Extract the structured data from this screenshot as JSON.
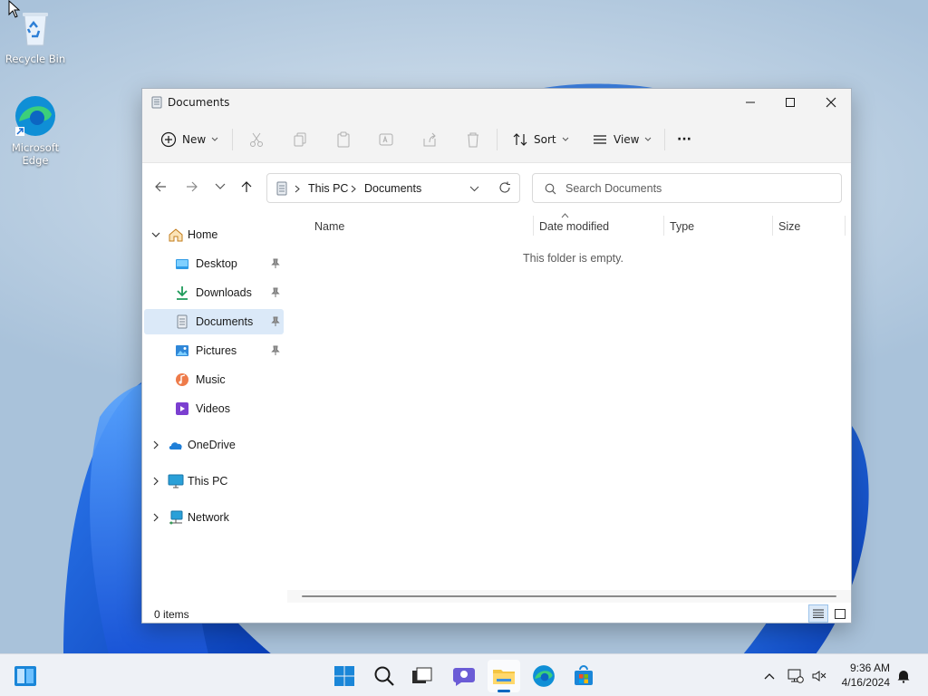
{
  "desktop": {
    "icons": [
      {
        "label": "Recycle Bin",
        "icon": "recycle-bin-icon"
      },
      {
        "label": "Microsoft Edge",
        "icon": "edge-icon"
      }
    ]
  },
  "window": {
    "title": "Documents",
    "caption_buttons": [
      "minimize-icon",
      "maximize-icon",
      "close-icon"
    ]
  },
  "commandbar": {
    "new_label": "New",
    "sort_label": "Sort",
    "view_label": "View",
    "more_label": "···"
  },
  "navigation": {
    "breadcrumb": [
      "This PC",
      "Documents"
    ],
    "search_placeholder": "Search Documents"
  },
  "sidebar": {
    "items": [
      {
        "label": "Home",
        "icon": "home-icon",
        "expanded": true
      },
      {
        "label": "Desktop",
        "icon": "desktop-folder-icon",
        "pinned": true
      },
      {
        "label": "Downloads",
        "icon": "downloads-icon",
        "pinned": true
      },
      {
        "label": "Documents",
        "icon": "documents-icon",
        "pinned": true,
        "selected": true
      },
      {
        "label": "Pictures",
        "icon": "pictures-icon",
        "pinned": true
      },
      {
        "label": "Music",
        "icon": "music-icon"
      },
      {
        "label": "Videos",
        "icon": "videos-icon"
      },
      {
        "label": "OneDrive",
        "icon": "onedrive-icon",
        "expanded": false
      },
      {
        "label": "This PC",
        "icon": "this-pc-icon",
        "expanded": false
      },
      {
        "label": "Network",
        "icon": "network-icon",
        "expanded": false
      }
    ]
  },
  "file_list": {
    "columns": [
      "Name",
      "Date modified",
      "Type",
      "Size"
    ],
    "empty_message": "This folder is empty."
  },
  "statusbar": {
    "item_count": "0 items"
  },
  "taskbar": {
    "apps": [
      "start-icon",
      "search-icon",
      "task-view-icon",
      "chat-icon",
      "file-explorer-icon",
      "edge-icon",
      "store-icon"
    ],
    "time": "9:36 AM",
    "date": "4/16/2024"
  },
  "colors": {
    "accent": "#0067c0",
    "selection": "#dbe9f8",
    "folder_yellow": "#f4c542"
  }
}
